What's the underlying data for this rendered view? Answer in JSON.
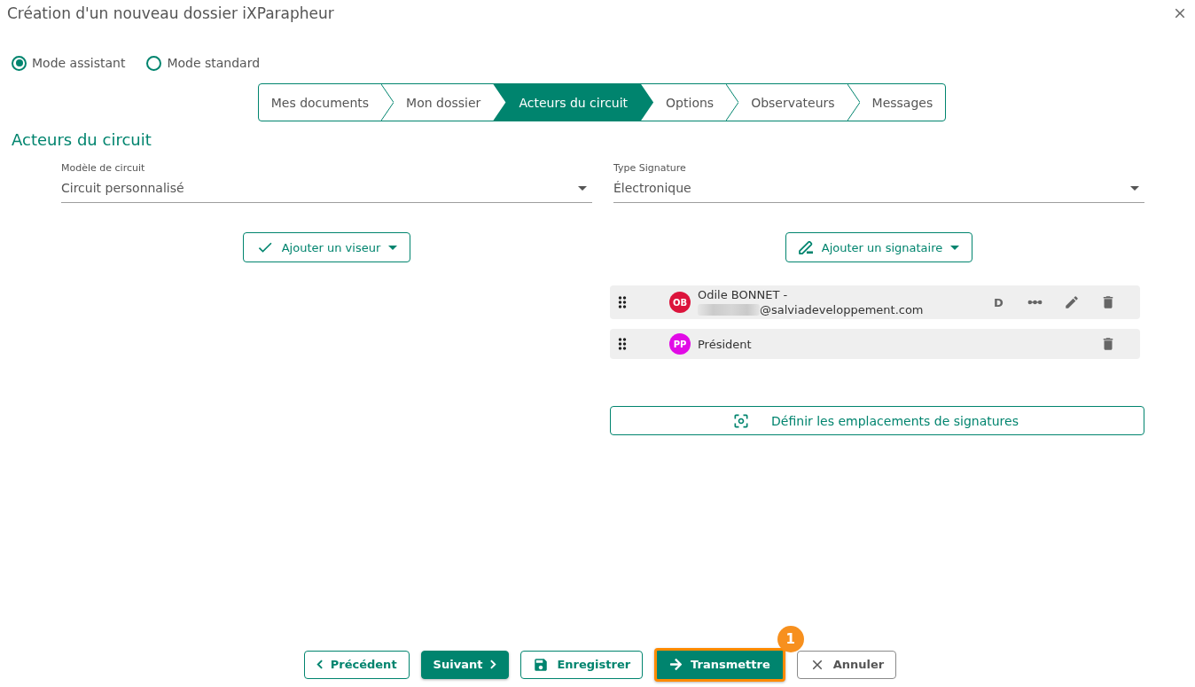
{
  "dialog": {
    "title": "Création d'un nouveau dossier iXParapheur"
  },
  "modes": [
    {
      "label": "Mode assistant",
      "selected": true
    },
    {
      "label": "Mode standard",
      "selected": false
    }
  ],
  "steps": [
    {
      "label": "Mes documents",
      "selected": false
    },
    {
      "label": "Mon dossier",
      "selected": false
    },
    {
      "label": "Acteurs du circuit",
      "selected": true
    },
    {
      "label": "Options",
      "selected": false
    },
    {
      "label": "Observateurs",
      "selected": false
    },
    {
      "label": "Messages",
      "selected": false
    }
  ],
  "section_title": "Acteurs du circuit",
  "fields": [
    {
      "label": "Modèle de circuit",
      "value": "Circuit personnalisé"
    },
    {
      "label": "Type Signature",
      "value": "Électronique"
    }
  ],
  "viewers": {
    "add_button": "Ajouter un viseur"
  },
  "signers": {
    "add_button": "Ajouter un signataire",
    "items": [
      {
        "initials": "OB",
        "color": "#dc143c",
        "name": "Odile BONNET -",
        "email": "@salviadeveloppement.com",
        "email_redacted": true,
        "actions": [
          {
            "kind": "mode",
            "label": "D"
          },
          {
            "kind": "steps"
          },
          {
            "kind": "edit"
          },
          {
            "kind": "delete"
          }
        ]
      },
      {
        "initials": "PP",
        "color": "#e10ae6",
        "name": "Président",
        "actions": [
          {
            "kind": "delete"
          }
        ]
      }
    ],
    "locate_button": "Définir les emplacements de signatures"
  },
  "footer": {
    "buttons": [
      {
        "kind": "previous",
        "label": "Précédent",
        "highlighted": false
      },
      {
        "kind": "next",
        "label": "Suivant",
        "highlighted": false
      },
      {
        "kind": "save",
        "label": "Enregistrer",
        "highlighted": false
      },
      {
        "kind": "send",
        "label": "Transmettre",
        "highlighted": true,
        "callout": "1"
      },
      {
        "kind": "cancel",
        "label": "Annuler",
        "highlighted": false
      }
    ]
  }
}
